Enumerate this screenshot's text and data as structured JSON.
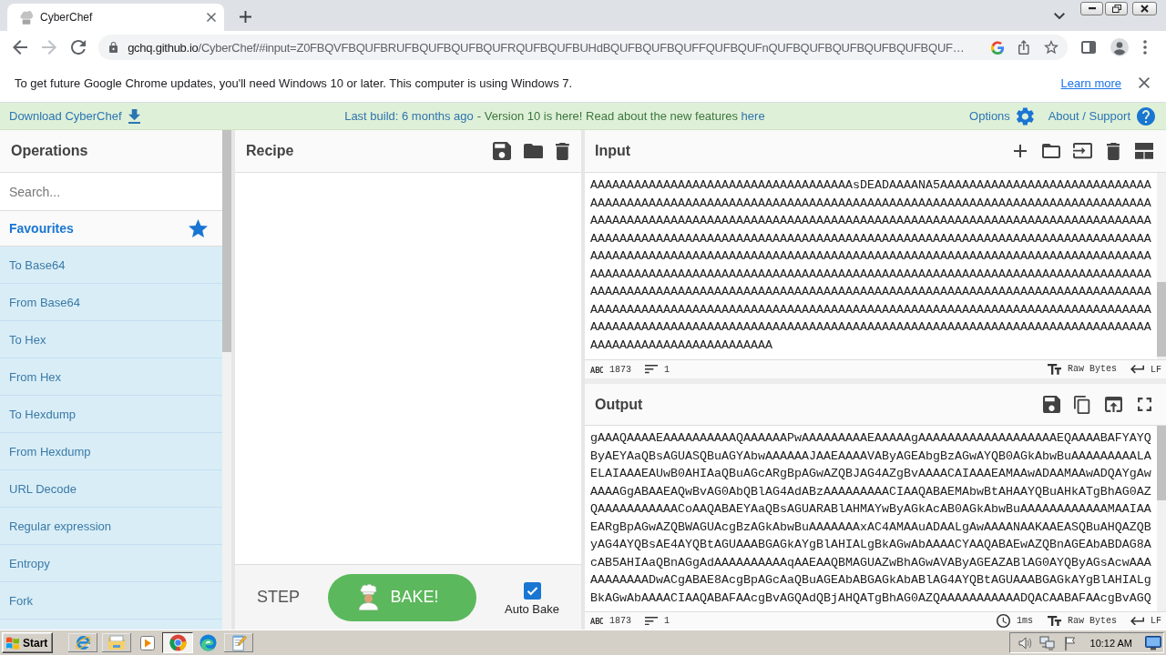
{
  "browser": {
    "tabs": [
      {
        "title": "CyberChef",
        "selected": true
      }
    ],
    "nav": [
      {
        "kind": "back",
        "disabled": false
      },
      {
        "kind": "forward",
        "disabled": true
      },
      {
        "kind": "reload",
        "disabled": false
      }
    ],
    "address": {
      "host": "gchq.github.io",
      "path": "/CyberChef/#input=Z0FBQVFBQUFBRUFBQUFBQUFBQUFRQUFBQUFBUHdBQUFBQUFBQUFFQUFBQUFnQUFBQUFBQUFBQUFBQUFBQUF…"
    },
    "infobar": {
      "message": "To get future Google Chrome updates, you'll need Windows 10 or later. This computer is using Windows 7.",
      "link": "Learn more"
    }
  },
  "banner": {
    "download": "Download CyberChef",
    "build": "Last build: 6 months ago",
    "notice": "- Version 10 is here! Read about the new features",
    "notice_link": "here",
    "options": "Options",
    "support": "About / Support"
  },
  "operations": {
    "title": "Operations",
    "search": {
      "placeholder": "Search..."
    },
    "category": "Favourites",
    "items": [
      "To Base64",
      "From Base64",
      "To Hex",
      "From Hex",
      "To Hexdump",
      "From Hexdump",
      "URL Decode",
      "Regular expression",
      "Entropy",
      "Fork"
    ]
  },
  "recipe": {
    "title": "Recipe",
    "step": "STEP",
    "bake": "BAKE!",
    "auto_bake": {
      "label": "Auto Bake",
      "checked": true
    }
  },
  "input": {
    "title": "Input",
    "lines": [
      "AAAAAAAAAAAAAAAAAAAAAAAAAAAAAAAAAAAAsDEADAAAANA5AAAAAAAAAAAAAAAAAAAAAAAAAAAAA",
      "AAAAAAAAAAAAAAAAAAAAAAAAAAAAAAAAAAAAAAAAAAAAAAAAAAAAAAAAAAAAAAAAAAAAAAAAAAAAA",
      "AAAAAAAAAAAAAAAAAAAAAAAAAAAAAAAAAAAAAAAAAAAAAAAAAAAAAAAAAAAAAAAAAAAAAAAAAAAAA",
      "AAAAAAAAAAAAAAAAAAAAAAAAAAAAAAAAAAAAAAAAAAAAAAAAAAAAAAAAAAAAAAAAAAAAAAAAAAAAA",
      "AAAAAAAAAAAAAAAAAAAAAAAAAAAAAAAAAAAAAAAAAAAAAAAAAAAAAAAAAAAAAAAAAAAAAAAAAAAAA",
      "AAAAAAAAAAAAAAAAAAAAAAAAAAAAAAAAAAAAAAAAAAAAAAAAAAAAAAAAAAAAAAAAAAAAAAAAAAAAA",
      "AAAAAAAAAAAAAAAAAAAAAAAAAAAAAAAAAAAAAAAAAAAAAAAAAAAAAAAAAAAAAAAAAAAAAAAAAAAAA",
      "AAAAAAAAAAAAAAAAAAAAAAAAAAAAAAAAAAAAAAAAAAAAAAAAAAAAAAAAAAAAAAAAAAAAAAAAAAAAA",
      "AAAAAAAAAAAAAAAAAAAAAAAAAAAAAAAAAAAAAAAAAAAAAAAAAAAAAAAAAAAAAAAAAAAAAAAAAAAAA",
      "AAAAAAAAAAAAAAAAAAAAAAAAA"
    ],
    "length": "1873",
    "line_count": "1",
    "format": "Raw Bytes",
    "eol": "LF"
  },
  "output": {
    "title": "Output",
    "lines": [
      "gAAAQAAAAEAAAAAAAAAAQAAAAAAPwAAAAAAAAAEAAAAAgAAAAAAAAAAAAAAAAAAAEQAAAABAFYAYQ",
      "ByAEYAaQBsAGUASQBuAGYAbwAAAAAAJAAEAAAAVAByAGEAbgBzAGwAYQB0AGkAbwBuAAAAAAAAALA",
      "ELAIAAAEAUwB0AHIAaQBuAGcARgBpAGwAZQBJAG4AZgBvAAAACAIAAAEAMAAwADAAMAAwADQAYgAw",
      "AAAAGgABAAEAQwBvAG0AbQBlAG4AdABzAAAAAAAAACIAAQABAEMAbwBtAHAAYQBuAHkATgBhAG0AZ",
      "QAAAAAAAAAAACoAAQABAEYAaQBsAGUARABlAHMAYwByAGkAcAB0AGkAbwBuAAAAAAAAAAAAMAAIAA",
      "EARgBpAGwAZQBWAGUAcgBzAGkAbwBuAAAAAAAxAC4AMAAuADAALgAwAAAANAAKAAEASQBuAHQAZQB",
      "yAG4AYQBsAE4AYQBtAGUAAABGAGkAYgBlAHIALgBkAGwAbAAAACYAAQABAEwAZQBnAGEAbABDAG8A",
      "cAB5AHIAaQBnAGgAdAAAAAAAAAAqAAEAAQBMAGUAZwBhAGwAVAByAGEAZABlAG0AYQByAGsAcwAAA",
      "AAAAAAAADwACgABAE8AcgBpAGcAaQBuAGEAbABGAGkAbABlAG4AYQBtAGUAAABGAGkAYgBlAHIALg",
      "BkAGwAbAAAACIAAQABAFAAcgBvAGQAdQBjAHQATgBhAG0AZQAAAAAAAAAAADQACAABAFAAcgBvAGQ"
    ],
    "length": "1873",
    "line_count": "1",
    "time": "1ms",
    "format": "Raw Bytes",
    "eol": "LF"
  },
  "taskbar": {
    "start": "Start",
    "apps": [
      {
        "kind": "ie",
        "running": true,
        "selected": false
      },
      {
        "kind": "explorer",
        "running": true,
        "selected": false
      },
      {
        "kind": "media",
        "running": false,
        "selected": false
      },
      {
        "kind": "chrome",
        "running": true,
        "selected": true
      },
      {
        "kind": "edge",
        "running": false,
        "selected": false
      },
      {
        "kind": "notepad",
        "running": true,
        "selected": false
      }
    ],
    "clock": "10:12 AM"
  }
}
